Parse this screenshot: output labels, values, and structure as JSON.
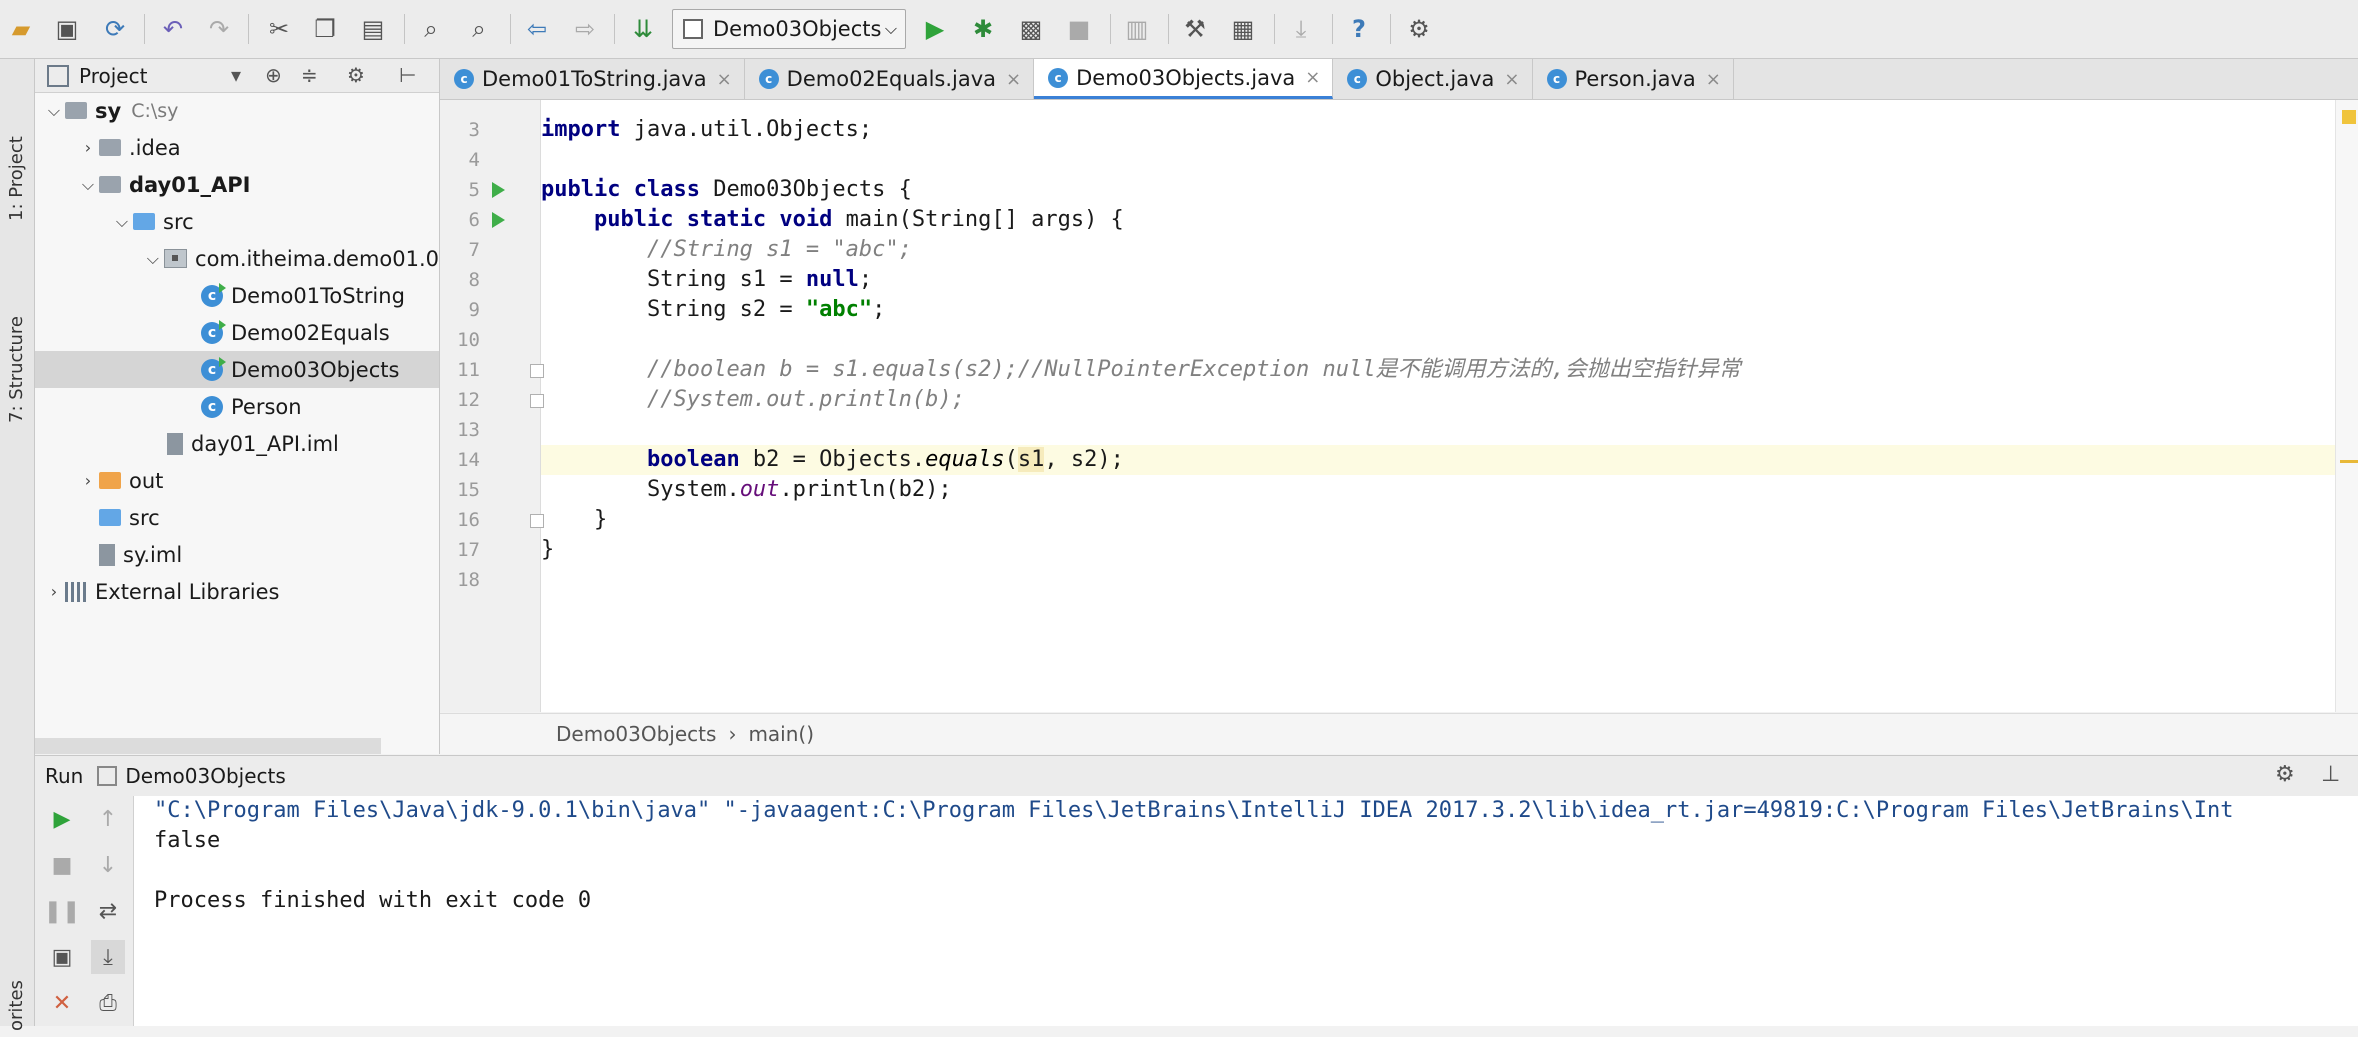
{
  "toolbar": {
    "run_config_label": "Demo03Objects",
    "icons": [
      "open-icon",
      "save-icon",
      "sync-icon",
      "undo-icon",
      "redo-icon",
      "cut-icon",
      "copy-icon",
      "paste-icon",
      "find-icon",
      "replace-icon",
      "back-icon",
      "forward-icon",
      "build-icon",
      "run-icon",
      "debug-icon",
      "coverage-icon",
      "stop-icon",
      "project-structure-icon",
      "settings-icon",
      "sdk-icon",
      "update-icon",
      "help-icon",
      "plugin-icon"
    ]
  },
  "left_strip": {
    "project_tab": "1: Project",
    "structure_tab": "7: Structure",
    "favorites_tab": "orites"
  },
  "project_panel": {
    "title": "Project",
    "tree": [
      {
        "label": "sy",
        "extra": "C:\\sy",
        "type": "module",
        "depth": 0,
        "arrow": "v",
        "bold": true
      },
      {
        "label": ".idea",
        "type": "folder-gray",
        "depth": 1,
        "arrow": ">"
      },
      {
        "label": "day01_API",
        "type": "module",
        "depth": 1,
        "arrow": "v",
        "bold": true
      },
      {
        "label": "src",
        "type": "folder-blue",
        "depth": 2,
        "arrow": "v"
      },
      {
        "label": "com.itheima.demo01.0",
        "type": "package",
        "depth": 3,
        "arrow": "v"
      },
      {
        "label": "Demo01ToString",
        "type": "class-run",
        "depth": 4,
        "arrow": ""
      },
      {
        "label": "Demo02Equals",
        "type": "class-run",
        "depth": 4,
        "arrow": ""
      },
      {
        "label": "Demo03Objects",
        "type": "class-run",
        "depth": 4,
        "arrow": "",
        "selected": true
      },
      {
        "label": "Person",
        "type": "class",
        "depth": 4,
        "arrow": ""
      },
      {
        "label": "day01_API.iml",
        "type": "file",
        "depth": 3,
        "arrow": ""
      },
      {
        "label": "out",
        "type": "folder-orange",
        "depth": 1,
        "arrow": ">"
      },
      {
        "label": "src",
        "type": "folder-blue",
        "depth": 1,
        "arrow": ""
      },
      {
        "label": "sy.iml",
        "type": "file",
        "depth": 1,
        "arrow": ""
      },
      {
        "label": "External Libraries",
        "type": "libs",
        "depth": 0,
        "arrow": ">"
      }
    ]
  },
  "editor": {
    "tabs": [
      {
        "label": "Demo01ToString.java",
        "active": false
      },
      {
        "label": "Demo02Equals.java",
        "active": false
      },
      {
        "label": "Demo03Objects.java",
        "active": true
      },
      {
        "label": "Object.java",
        "active": false
      },
      {
        "label": "Person.java",
        "active": false
      }
    ],
    "line_numbers": [
      "3",
      "4",
      "5",
      "6",
      "7",
      "8",
      "9",
      "10",
      "11",
      "12",
      "13",
      "14",
      "15",
      "16",
      "17",
      "18"
    ],
    "code": {
      "l3_kw": "import",
      "l3_rest": " java.util.Objects;",
      "l5_kw": "public class",
      "l5_rest": " Demo03Objects {",
      "l6_kw": "public static void",
      "l6_rest": " main(String[] args) {",
      "l7_comment": "//String s1 = \"abc\";",
      "l8_a": "String s1 = ",
      "l8_kw": "null",
      "l8_b": ";",
      "l9_a": "String s2 = ",
      "l9_str": "\"abc\"",
      "l9_b": ";",
      "l11_comment": "//boolean b = s1.equals(s2);//NullPointerException null是不能调用方法的,会抛出空指针异常",
      "l12_comment": "//System.out.println(b);",
      "l14_kw": "boolean",
      "l14_a": " b2 = Objects.",
      "l14_method": "equals",
      "l14_b": "(",
      "l14_hl": "s1",
      "l14_c": ", s2);",
      "l15_a": "System.",
      "l15_field": "out",
      "l15_b": ".println(b2);",
      "l16": "}",
      "l17": "}"
    },
    "breadcrumb": [
      "Demo03Objects",
      "main()"
    ]
  },
  "run_panel": {
    "title": "Run",
    "config": "Demo03Objects",
    "console": [
      "\"C:\\Program Files\\Java\\jdk-9.0.1\\bin\\java\" \"-javaagent:C:\\Program Files\\JetBrains\\IntelliJ IDEA 2017.3.2\\lib\\idea_rt.jar=49819:C:\\Program Files\\JetBrains\\Int",
      "false",
      "",
      "Process finished with exit code 0"
    ]
  }
}
